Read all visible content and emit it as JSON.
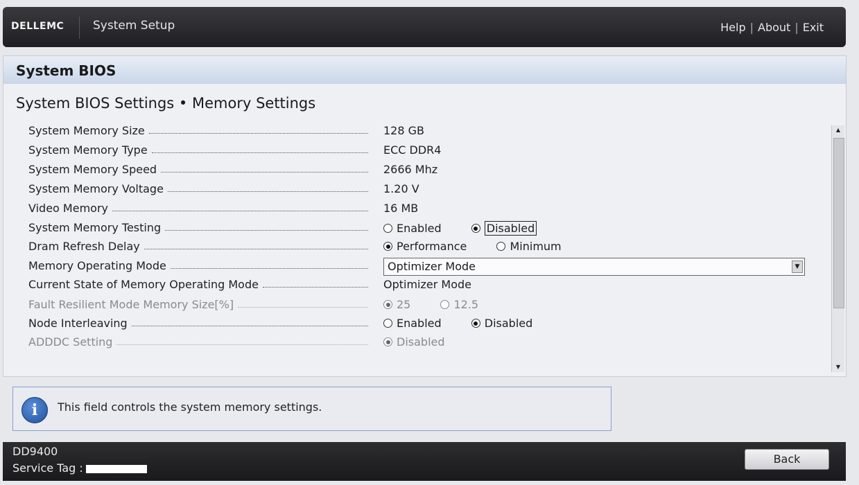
{
  "header": {
    "logo": "DELLEMC",
    "app_title": "System Setup",
    "links": [
      "Help",
      "About",
      "Exit"
    ]
  },
  "page": {
    "title": "System BIOS",
    "section": "System BIOS Settings • Memory Settings"
  },
  "settings": [
    {
      "label": "System Memory Size",
      "value": "128 GB"
    },
    {
      "label": "System Memory Type",
      "value": "ECC DDR4"
    },
    {
      "label": "System Memory Speed",
      "value": "2666 Mhz"
    },
    {
      "label": "System Memory Voltage",
      "value": "1.20 V"
    },
    {
      "label": "Video Memory",
      "value": "16 MB"
    },
    {
      "label": "System Memory Testing",
      "options": [
        "Enabled",
        "Disabled"
      ],
      "selected": "Disabled"
    },
    {
      "label": "Dram Refresh Delay",
      "options": [
        "Performance",
        "Minimum"
      ],
      "selected": "Performance"
    },
    {
      "label": "Memory Operating Mode",
      "select_value": "Optimizer Mode"
    },
    {
      "label": "Current State of Memory Operating Mode",
      "value": "Optimizer Mode"
    },
    {
      "label": "Fault Resilient Mode Memory Size[%]",
      "options": [
        "25",
        "12.5"
      ],
      "selected": "25",
      "disabled": true
    },
    {
      "label": "Node Interleaving",
      "options": [
        "Enabled",
        "Disabled"
      ],
      "selected": "Disabled"
    },
    {
      "label": "ADDDC Setting",
      "options": [
        "Disabled"
      ],
      "selected": "Disabled",
      "disabled": true
    }
  ],
  "info": {
    "icon": "info-icon",
    "text": "This field controls the system memory settings."
  },
  "footer": {
    "model": "DD9400",
    "service_tag_label": "Service Tag :",
    "back_label": "Back"
  },
  "colors": {
    "header_bg": "#2a2a2d",
    "bios_bar": "#c9d7ea",
    "info_border": "#8aa0c8"
  }
}
